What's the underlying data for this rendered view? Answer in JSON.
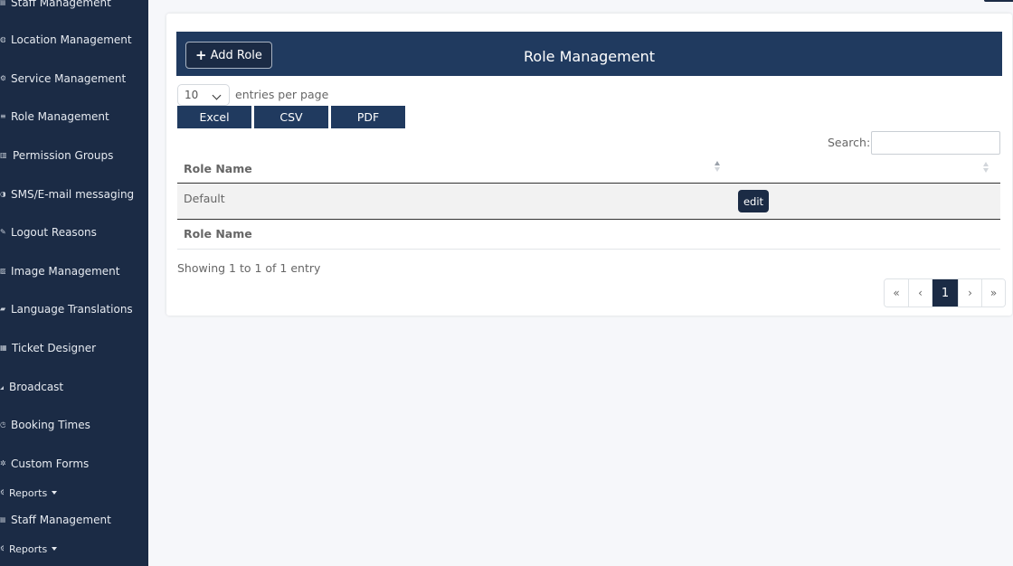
{
  "sidebar": {
    "items": [
      {
        "label": "Staff Management",
        "icon": "staff-icon"
      },
      {
        "label": "Location Management",
        "icon": "location-icon"
      },
      {
        "label": "Service Management",
        "icon": "service-icon"
      },
      {
        "label": "Role Management",
        "icon": "list-icon"
      },
      {
        "label": "Permission Groups",
        "icon": "lock-icon"
      },
      {
        "label": "SMS/E-mail messaging",
        "icon": "message-icon"
      },
      {
        "label": "Logout Reasons",
        "icon": "pencil-icon"
      },
      {
        "label": "Image Management",
        "icon": "image-icon"
      },
      {
        "label": "Language Translations",
        "icon": "translate-icon"
      },
      {
        "label": "Ticket Designer",
        "icon": "ticket-icon"
      },
      {
        "label": "Broadcast",
        "icon": "broadcast-icon"
      },
      {
        "label": "Booking Times",
        "icon": "clock-icon"
      },
      {
        "label": "Custom Forms",
        "icon": "gear-icon"
      },
      {
        "label": "Reports",
        "icon": "reports-icon"
      },
      {
        "label": "Staff Management",
        "icon": "staff-icon"
      },
      {
        "label": "Reports",
        "icon": "reports-icon"
      }
    ]
  },
  "header": {
    "add_role_label": "Add Role",
    "title": "Role Management"
  },
  "controls": {
    "entries_value": "10",
    "entries_label": "entries per page",
    "export_buttons": [
      "Excel",
      "CSV",
      "PDF"
    ],
    "search_label": "Search:",
    "search_value": ""
  },
  "table": {
    "columns": [
      "Role Name",
      ""
    ],
    "rows": [
      {
        "role_name": "Default",
        "action_label": "edit"
      }
    ],
    "footer_columns": [
      "Role Name"
    ]
  },
  "info_text": "Showing 1 to 1 of 1 entry",
  "pagination": {
    "first": "«",
    "prev": "‹",
    "current": "1",
    "next": "›",
    "last": "»"
  },
  "colors": {
    "sidebar_bg": "#1b2b45",
    "header_bg": "#203a5f",
    "page_bg": "#f6f7fa"
  }
}
